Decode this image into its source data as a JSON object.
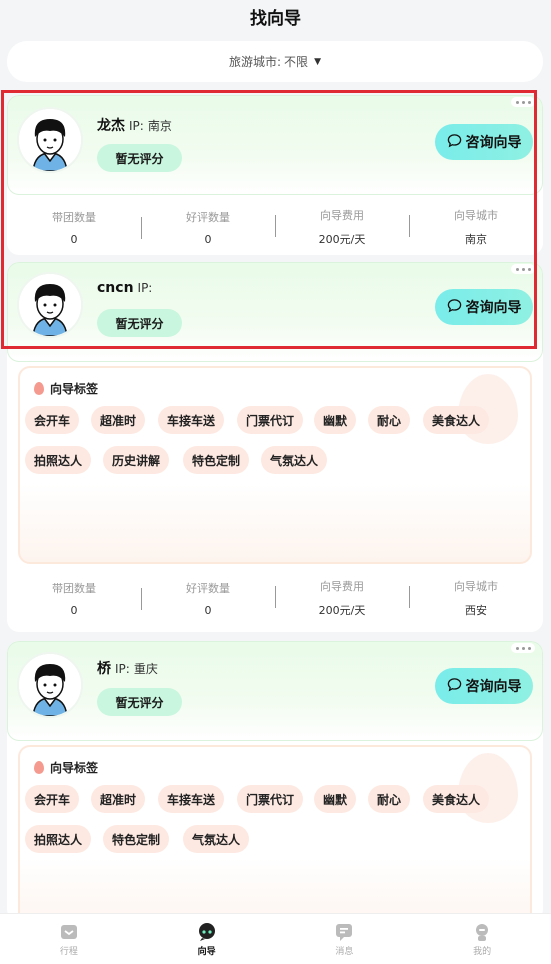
{
  "page": {
    "title": "找向导"
  },
  "filter": {
    "label": "旅游城市:",
    "value": "不限"
  },
  "stat_labels": {
    "groups": "带团数量",
    "good_reviews": "好评数量",
    "fee": "向导费用",
    "city": "向导城市"
  },
  "guides": [
    {
      "name": "龙杰",
      "ip_label": "IP:",
      "ip_value": "南京",
      "rating": "暂无评分",
      "consult": "咨询向导",
      "stats": {
        "groups": "0",
        "good_reviews": "0",
        "fee": "200元/天",
        "city": "南京"
      }
    },
    {
      "name": "cncn",
      "ip_label": "IP:",
      "ip_value": "",
      "rating": "暂无评分",
      "consult": "咨询向导",
      "tags_title": "向导标签",
      "tags": [
        "会开车",
        "超准时",
        "车接车送",
        "门票代订",
        "幽默",
        "耐心",
        "美食达人",
        "拍照达人",
        "历史讲解",
        "特色定制",
        "气氛达人"
      ],
      "stats": {
        "groups": "0",
        "good_reviews": "0",
        "fee": "200元/天",
        "city": "西安"
      }
    },
    {
      "name": "桥",
      "ip_label": "IP:",
      "ip_value": "重庆",
      "rating": "暂无评分",
      "consult": "咨询向导",
      "tags_title": "向导标签",
      "tags": [
        "会开车",
        "超准时",
        "车接车送",
        "门票代订",
        "幽默",
        "耐心",
        "美食达人",
        "拍照达人",
        "特色定制",
        "气氛达人"
      ]
    }
  ],
  "tabbar": [
    {
      "label": "行程",
      "icon": "itinerary-icon",
      "active": false
    },
    {
      "label": "向导",
      "icon": "guide-icon",
      "active": true
    },
    {
      "label": "消息",
      "icon": "message-icon",
      "active": false
    },
    {
      "label": "我的",
      "icon": "profile-icon",
      "active": false
    }
  ],
  "colors": {
    "accent": "#79ecea",
    "rating_bg": "#c9f6de",
    "tag_bg": "#fde9e2",
    "highlight": "#e02a33"
  }
}
